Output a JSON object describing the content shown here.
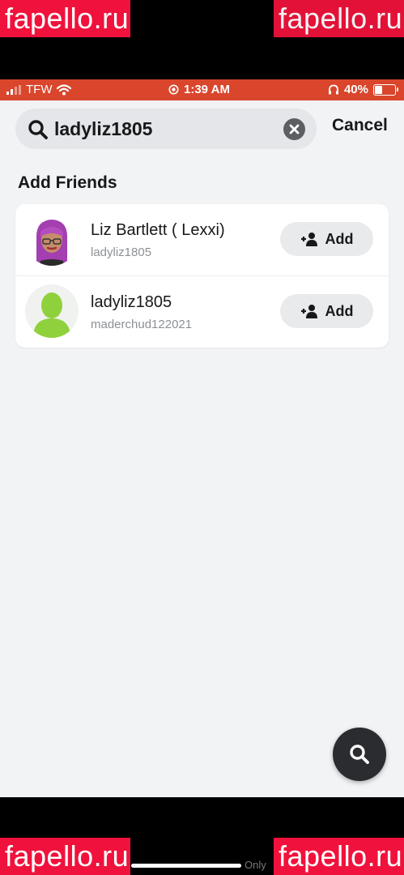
{
  "watermarks": {
    "top_left": "fapello.ru",
    "top_right": "fapello.ru",
    "bottom_left": "fapello.ru",
    "bottom_right": "fapello.ru"
  },
  "bottom_text": "Only",
  "status_bar": {
    "carrier": "TFW",
    "time": "1:39 AM",
    "battery_percent": "40%",
    "battery_level": 0.4,
    "background": "#d9462c"
  },
  "search": {
    "query": "ladyliz1805",
    "cancel_label": "Cancel"
  },
  "section_title": "Add Friends",
  "results": [
    {
      "name": "Liz Bartlett ( Lexxi)",
      "username": "ladyliz1805",
      "add_label": "Add",
      "avatar": "bitmoji-avatar-purple-hair"
    },
    {
      "name": "ladyliz1805",
      "username": "maderchud122021",
      "add_label": "Add",
      "avatar": "default-green-silhouette-avatar"
    }
  ],
  "colors": {
    "accent_green": "#8fd13c",
    "watermark_red": "#f0123c"
  }
}
